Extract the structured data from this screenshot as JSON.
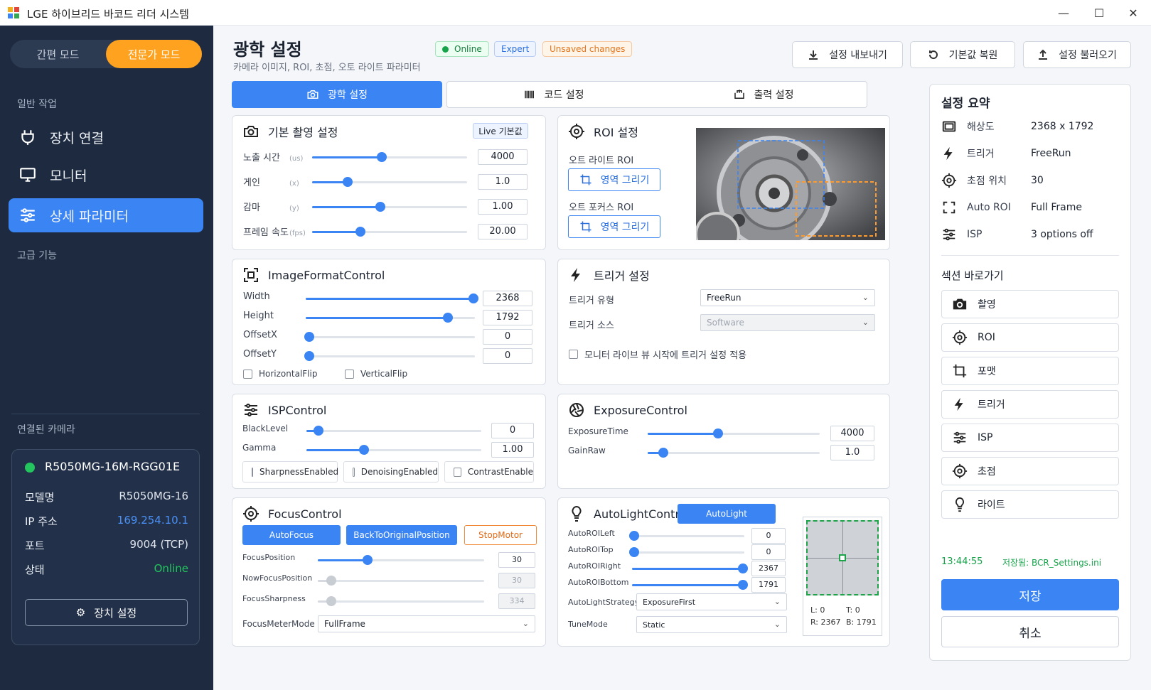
{
  "window": {
    "title": "LGE 하이브리드 바코드 리더 시스템"
  },
  "sidebar": {
    "modes": [
      "간편 모드",
      "전문가 모드"
    ],
    "group_general": "일반 작업",
    "items": [
      {
        "label": "장치 연결",
        "icon": "plug-icon"
      },
      {
        "label": "모니터",
        "icon": "monitor-icon"
      },
      {
        "label": "상세 파라미터",
        "icon": "sliders-icon"
      }
    ],
    "group_advanced": "고급 기능",
    "camera_section": "연결된 카메라",
    "camera": {
      "name": "R5050MG-16M-RGG01E",
      "rows": [
        {
          "k": "모델명",
          "v": "R5050MG-16"
        },
        {
          "k": "IP 주소",
          "v": "169.254.10.1"
        },
        {
          "k": "포트",
          "v": "9004 (TCP)"
        },
        {
          "k": "상태",
          "v": "Online"
        }
      ],
      "device_button": "장치 설정"
    }
  },
  "header": {
    "title": "광학 설정",
    "subtitle": "카메라 이미지, ROI, 초점, 오토 라이트 파라미터",
    "badges": [
      "Online",
      "Expert",
      "Unsaved changes"
    ],
    "buttons": [
      "설정 내보내기",
      "기본값 복원",
      "설정 불러오기"
    ]
  },
  "tabs": [
    "광학 설정",
    "코드 설정",
    "출력 설정"
  ],
  "basic": {
    "title": "기본 촬영 설정",
    "live_btn": "Live 기본값",
    "rows": [
      {
        "label": "노출 시간",
        "unit": "(us)",
        "value": "4000",
        "pct": 0.45
      },
      {
        "label": "게인",
        "unit": "(x)",
        "value": "1.0",
        "pct": 0.23
      },
      {
        "label": "감마",
        "unit": "(y)",
        "value": "1.00",
        "pct": 0.44
      },
      {
        "label": "프레임 속도",
        "unit": "(fps)",
        "value": "20.00",
        "pct": 0.31
      }
    ]
  },
  "roi": {
    "title": "ROI 설정",
    "autolight_label": "오트 라이트 ROI",
    "autofocus_label": "오트 포커스 ROI",
    "draw_button": "영역 그리기"
  },
  "imageformat": {
    "title": "ImageFormatControl",
    "rows": [
      {
        "label": "Width",
        "value": "2368",
        "pct": 0.99
      },
      {
        "label": "Height",
        "value": "1792",
        "pct": 0.84
      },
      {
        "label": "OffsetX",
        "value": "0",
        "pct": 0.02
      },
      {
        "label": "OffsetY",
        "value": "0",
        "pct": 0.02
      }
    ],
    "checks": [
      "HorizontalFlip",
      "VerticalFlip"
    ]
  },
  "trigger": {
    "title": "트리거 설정",
    "type_label": "트리거 유형",
    "type_value": "FreeRun",
    "source_label": "트리거 소스",
    "source_value": "Software",
    "check": "모니터 라이브 뷰 시작에 트리거 설정 적용"
  },
  "isp": {
    "title": "ISPControl",
    "rows": [
      {
        "label": "BlackLevel",
        "value": "0",
        "pct": 0.07
      },
      {
        "label": "Gamma",
        "value": "1.00",
        "pct": 0.33
      }
    ],
    "checks": [
      "SharpnessEnabled",
      "DenoisingEnabled",
      "ContrastEnable"
    ]
  },
  "exposure": {
    "title": "ExposureControl",
    "rows": [
      {
        "label": "ExposureTime",
        "value": "4000",
        "pct": 0.41
      },
      {
        "label": "GainRaw",
        "value": "1.0",
        "pct": 0.09
      }
    ]
  },
  "focus": {
    "title": "FocusControl",
    "buttons": [
      "AutoFocus",
      "BackToOriginalPosition",
      "StopMotor"
    ],
    "rows": [
      {
        "label": "FocusPosition",
        "value": "30",
        "pct": 0.3,
        "disabled": false
      },
      {
        "label": "NowFocusPosition",
        "value": "30",
        "pct": 0.08,
        "disabled": true
      },
      {
        "label": "FocusSharpness",
        "value": "334",
        "pct": 0.08,
        "disabled": true
      }
    ],
    "meter_label": "FocusMeterMode",
    "meter_value": "FullFrame"
  },
  "autolight": {
    "title": "AutoLightControl",
    "button": "AutoLight",
    "rows": [
      {
        "label": "AutoROILeft",
        "value": "0",
        "pct": 0.02
      },
      {
        "label": "AutoROITop",
        "value": "0",
        "pct": 0.02
      },
      {
        "label": "AutoROIRight",
        "value": "2367",
        "pct": 0.99
      },
      {
        "label": "AutoROIBottom",
        "value": "1791",
        "pct": 0.99
      }
    ],
    "strategy_label": "AutoLightStrategy",
    "strategy_value": "ExposureFirst",
    "tune_label": "TuneMode",
    "tune_value": "Static",
    "preview": {
      "l": "L: 0",
      "t": "T: 0",
      "r": "R: 2367",
      "b": "B: 1791"
    }
  },
  "summary": {
    "title": "설정 요약",
    "rows": [
      {
        "k": "해상도",
        "v": "2368 x 1792",
        "icon": "resolution-icon"
      },
      {
        "k": "트리거",
        "v": "FreeRun",
        "icon": "bolt-icon"
      },
      {
        "k": "초점 위치",
        "v": "30",
        "icon": "target-icon"
      },
      {
        "k": "Auto ROI",
        "v": "Full Frame",
        "icon": "roi-icon"
      },
      {
        "k": "ISP",
        "v": "3 options off",
        "icon": "sliders-icon"
      }
    ],
    "shortcut_title": "섹션 바로가기",
    "shortcuts": [
      "촬영",
      "ROI",
      "포맷",
      "트리거",
      "ISP",
      "초점",
      "라이트"
    ],
    "time": "13:44:55",
    "saved": "저장됨: BCR_Settings.ini",
    "save": "저장",
    "cancel": "취소"
  },
  "colors": {
    "accent": "#3a84f4",
    "orange": "#ffa21f",
    "online": "#22c55e",
    "sidebar": "#1d2a3f"
  }
}
